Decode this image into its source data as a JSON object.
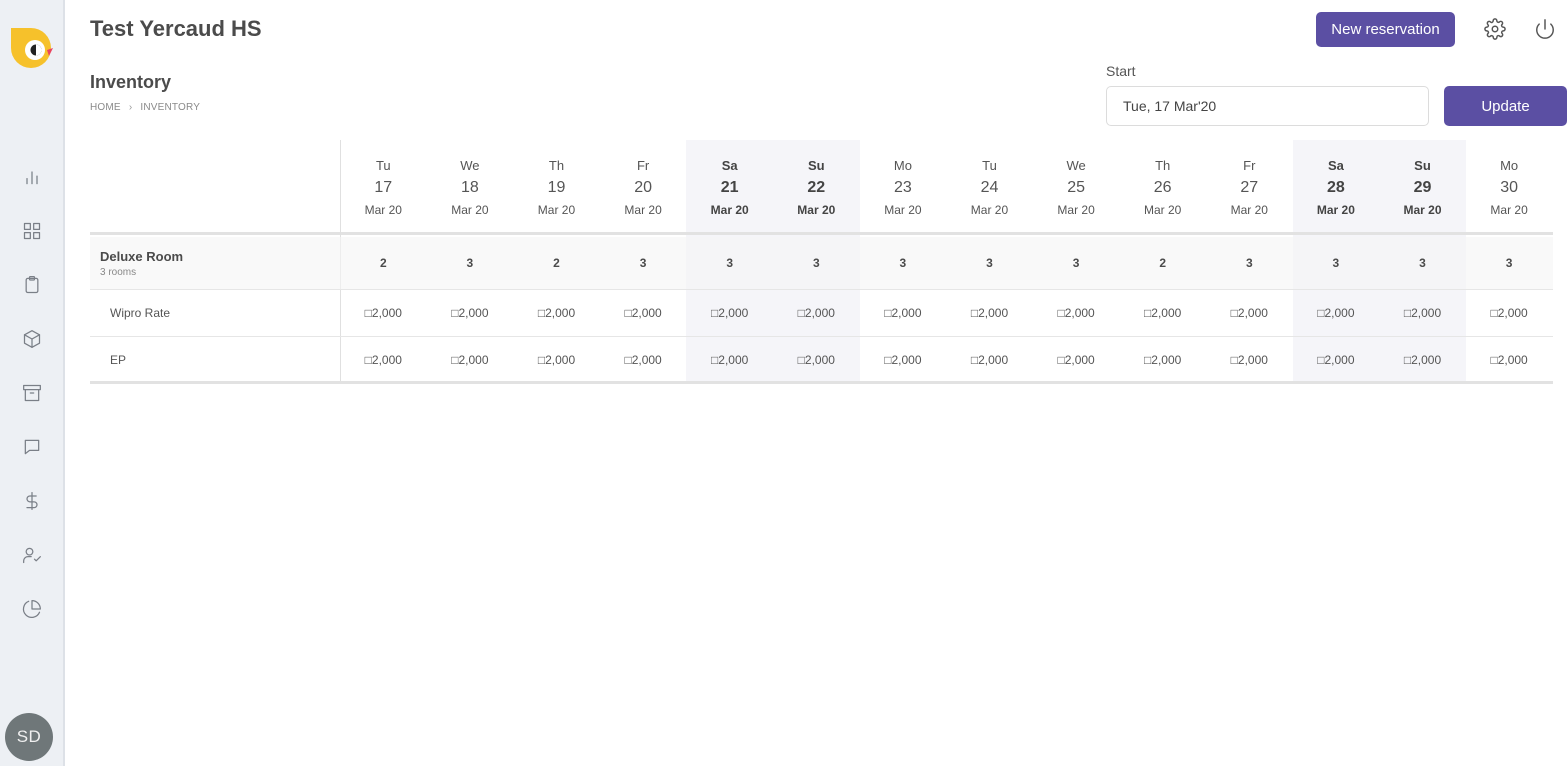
{
  "app": {
    "title": "Test Yercaud HS",
    "user_initials": "SD"
  },
  "header": {
    "new_reservation_label": "New reservation"
  },
  "page": {
    "title": "Inventory",
    "breadcrumb": [
      "HOME",
      "INVENTORY"
    ]
  },
  "date_picker": {
    "label": "Start",
    "value": "Tue, 17 Mar'20",
    "update_label": "Update"
  },
  "sidebar": {
    "icons": [
      "bar-chart-icon",
      "grid-icon",
      "clipboard-icon",
      "box-icon",
      "archive-icon",
      "message-icon",
      "dollar-icon",
      "user-check-icon",
      "pie-chart-icon"
    ]
  },
  "colors": {
    "accent": "#5b4fa3",
    "sidebar_bg": "#edf0f4",
    "weekend_bg": "#f5f5f9",
    "avatar": "#6f7779"
  },
  "inventory": {
    "days": [
      {
        "dow": "Tu",
        "day": "17",
        "month": "Mar 20",
        "weekend": false
      },
      {
        "dow": "We",
        "day": "18",
        "month": "Mar 20",
        "weekend": false
      },
      {
        "dow": "Th",
        "day": "19",
        "month": "Mar 20",
        "weekend": false
      },
      {
        "dow": "Fr",
        "day": "20",
        "month": "Mar 20",
        "weekend": false
      },
      {
        "dow": "Sa",
        "day": "21",
        "month": "Mar 20",
        "weekend": true
      },
      {
        "dow": "Su",
        "day": "22",
        "month": "Mar 20",
        "weekend": true
      },
      {
        "dow": "Mo",
        "day": "23",
        "month": "Mar 20",
        "weekend": false
      },
      {
        "dow": "Tu",
        "day": "24",
        "month": "Mar 20",
        "weekend": false
      },
      {
        "dow": "We",
        "day": "25",
        "month": "Mar 20",
        "weekend": false
      },
      {
        "dow": "Th",
        "day": "26",
        "month": "Mar 20",
        "weekend": false
      },
      {
        "dow": "Fr",
        "day": "27",
        "month": "Mar 20",
        "weekend": false
      },
      {
        "dow": "Sa",
        "day": "28",
        "month": "Mar 20",
        "weekend": true
      },
      {
        "dow": "Su",
        "day": "29",
        "month": "Mar 20",
        "weekend": true
      },
      {
        "dow": "Mo",
        "day": "30",
        "month": "Mar 20",
        "weekend": false
      }
    ],
    "room": {
      "name": "Deluxe Room",
      "subtitle": "3 rooms",
      "availability": [
        "2",
        "3",
        "2",
        "3",
        "3",
        "3",
        "3",
        "3",
        "3",
        "2",
        "3",
        "3",
        "3",
        "3"
      ]
    },
    "rates": [
      {
        "name": "Wipro Rate",
        "values": [
          "□2,000",
          "□2,000",
          "□2,000",
          "□2,000",
          "□2,000",
          "□2,000",
          "□2,000",
          "□2,000",
          "□2,000",
          "□2,000",
          "□2,000",
          "□2,000",
          "□2,000",
          "□2,000"
        ]
      },
      {
        "name": "EP",
        "values": [
          "□2,000",
          "□2,000",
          "□2,000",
          "□2,000",
          "□2,000",
          "□2,000",
          "□2,000",
          "□2,000",
          "□2,000",
          "□2,000",
          "□2,000",
          "□2,000",
          "□2,000",
          "□2,000"
        ]
      }
    ]
  }
}
